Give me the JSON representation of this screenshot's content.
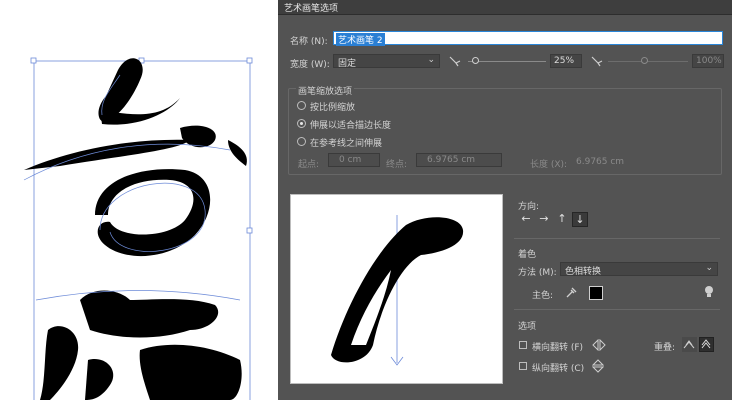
{
  "dialog": {
    "title": "艺术画笔选项",
    "name_label": "名称 (N):",
    "name_value": "艺术画笔 2",
    "width_label": "宽度 (W):",
    "width_select": "固定",
    "width_percent": "25%",
    "width_max_percent": "100%",
    "scale_group_title": "画笔缩放选项",
    "scale_options": [
      "按比例缩放",
      "伸展以适合描边长度",
      "在参考线之间伸展"
    ],
    "scale_selected_index": 1,
    "start_label": "起点:",
    "start_value": "0 cm",
    "end_label": "终点:",
    "end_value": "6.9765 cm",
    "length_label": "长度 (X):",
    "length_value": "6.9765 cm",
    "direction_title": "方向:",
    "direction_arrows": [
      "←",
      "→",
      "↑",
      "↓"
    ],
    "direction_selected_index": 3,
    "color_title": "着色",
    "method_label": "方法 (M):",
    "method_value": "色相转换",
    "key_color_label": "主色:",
    "options_title": "选项",
    "flip_horizontal_label": "横向翻转 (F)",
    "flip_vertical_label": "纵向翻转 (C)",
    "overlap_label": "重叠:",
    "key_color": "#000000",
    "accent_color": "#2a7fd4"
  },
  "icons": {
    "width_min": "pressure-brush-icon",
    "width_max": "pressure-brush-icon",
    "eyedropper": "eyedropper-icon",
    "tip": "lightbulb-icon",
    "flip_h": "flip-horizontal-icon",
    "flip_v": "flip-vertical-icon"
  }
}
